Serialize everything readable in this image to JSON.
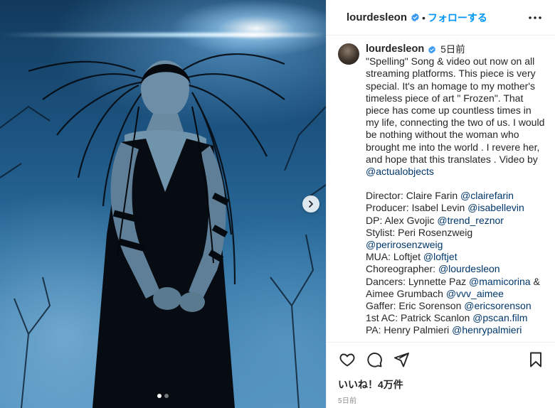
{
  "header": {
    "username": "lourdesleon",
    "separator": "•",
    "follow_label": "フォローする"
  },
  "caption": {
    "username": "lourdesleon",
    "time": "5日前",
    "main_text_before_mention": "\"Spelling\" Song & video out now on all streaming platforms. This piece is very special. It's an homage to my mother's timeless piece of art \" Frozen\". That piece has come up countless times in my life, connecting the two of us. I would be nothing without the woman who brought me into the world . I revere her, and hope that this translates . Video by ",
    "main_mention": "@actualobjects",
    "credits": [
      {
        "label": "Director: Claire Farin ",
        "mention": "@clairefarin"
      },
      {
        "label": "Producer: Isabel Levin ",
        "mention": "@isabellevin"
      },
      {
        "label": "DP: Alex Gvojic ",
        "mention": "@trend_reznor"
      },
      {
        "label": "Stylist: Peri Rosenzweig ",
        "mention": "@perirosenzweig"
      },
      {
        "label": "MUA: Loftjet ",
        "mention": "@loftjet"
      },
      {
        "label": "Choreographer: ",
        "mention": "@lourdesleon"
      },
      {
        "label": "Dancers: Lynnette Paz ",
        "mention": "@mamicorina",
        "suffix": " & Aimee Grumbach ",
        "mention2": "@vvv_aimee"
      },
      {
        "label": "Gaffer: Eric Sorenson ",
        "mention": "@ericsorenson"
      },
      {
        "label": "1st AC: Patrick Scanlon ",
        "mention": "@pscan.film"
      },
      {
        "label": "PA: Henry Palmieri ",
        "mention": "@henrypalmieri"
      }
    ]
  },
  "engagement": {
    "likes_text": "いいね！4万件",
    "date_text": "5日前"
  },
  "carousel": {
    "total_slides": 2,
    "active_index": 0
  },
  "colors": {
    "accent_blue": "#0095f6",
    "verified_blue": "#3897f0",
    "mention_blue": "#00376b",
    "secondary_text": "#8e8e8e"
  },
  "icons": {
    "more": "more-horizontal-icon",
    "next": "chevron-right-icon",
    "like": "heart-icon",
    "comment": "comment-icon",
    "share": "paper-plane-icon",
    "save": "bookmark-icon"
  }
}
